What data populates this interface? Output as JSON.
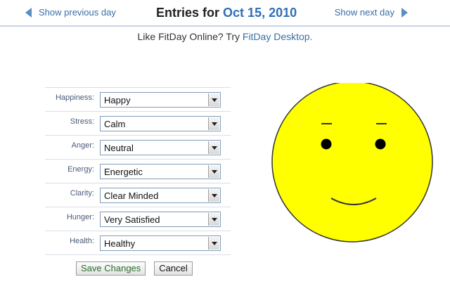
{
  "header": {
    "prev_day_label": "Show previous day",
    "next_day_label": "Show next day",
    "entries_prefix": "Entries for",
    "entries_date": "Oct 15, 2010"
  },
  "promo": {
    "text": "Like FitDay Online? Try",
    "link": "FitDay Desktop."
  },
  "mood": {
    "fields": [
      {
        "label": "Happiness:",
        "value": "Happy"
      },
      {
        "label": "Stress:",
        "value": "Calm"
      },
      {
        "label": "Anger:",
        "value": "Neutral"
      },
      {
        "label": "Energy:",
        "value": "Energetic"
      },
      {
        "label": "Clarity:",
        "value": "Clear Minded"
      },
      {
        "label": "Hunger:",
        "value": "Very Satisfied"
      },
      {
        "label": "Health:",
        "value": "Healthy"
      }
    ]
  },
  "buttons": {
    "save": "Save Changes",
    "cancel": "Cancel"
  },
  "colors": {
    "accent": "#2e6fb6",
    "smiley_face": "#ffff00"
  }
}
